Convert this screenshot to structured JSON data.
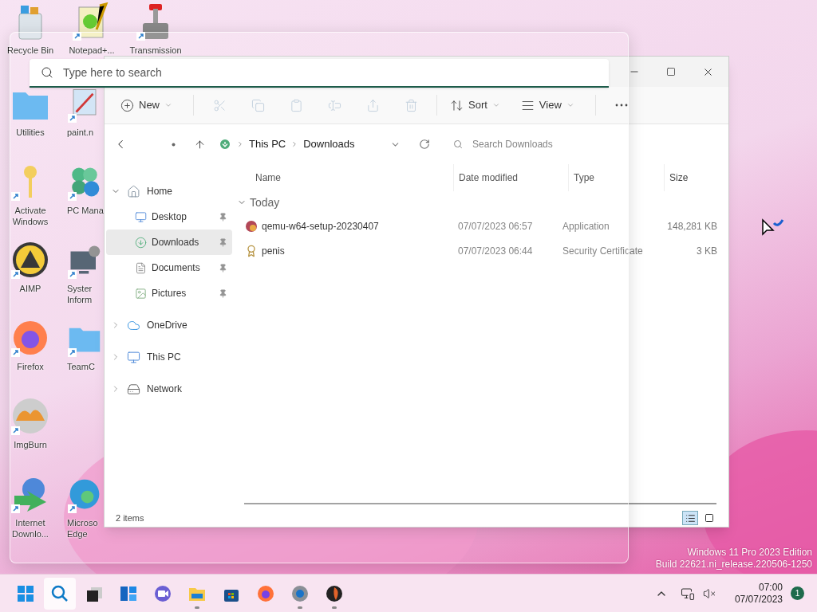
{
  "desktop_icons": [
    {
      "label": "Recycle Bin",
      "shortcut": false
    },
    {
      "label": "Notepad+...",
      "shortcut": true
    },
    {
      "label": "Transmission",
      "shortcut": true
    },
    {
      "label": "Utilities",
      "shortcut": false
    },
    {
      "label": "paint.n",
      "shortcut": true
    },
    {
      "label": "Activate Windows",
      "shortcut": true
    },
    {
      "label": "PC Mana",
      "shortcut": true
    },
    {
      "label": "AIMP",
      "shortcut": true
    },
    {
      "label": "Syster Inform",
      "shortcut": true
    },
    {
      "label": "Firefox",
      "shortcut": true
    },
    {
      "label": "TeamC",
      "shortcut": true
    },
    {
      "label": "ImgBurn",
      "shortcut": true
    },
    {
      "label": "Internet Downlo...",
      "shortcut": true
    },
    {
      "label": "Microso Edge",
      "shortcut": true
    }
  ],
  "search": {
    "placeholder": "Type here to search"
  },
  "explorer": {
    "toolbar": [
      {
        "label": "New",
        "disabled": false,
        "dropdown": true
      },
      {
        "disabled": true
      },
      {
        "disabled": true
      },
      {
        "disabled": true
      },
      {
        "disabled": true
      },
      {
        "disabled": true
      },
      {
        "disabled": true
      },
      {
        "label": "Sort",
        "disabled": false,
        "dropdown": true
      },
      {
        "label": "View",
        "disabled": false,
        "dropdown": true
      },
      {
        "disabled": false
      }
    ],
    "address": {
      "path": [
        "This PC",
        "Downloads"
      ],
      "search_placeholder": "Search Downloads"
    },
    "sidebar": [
      {
        "label": "Home",
        "expanded": true,
        "selected": false,
        "children": [
          {
            "label": "Desktop",
            "selected": false,
            "pinned": true
          },
          {
            "label": "Downloads",
            "selected": true,
            "pinned": true
          },
          {
            "label": "Documents",
            "selected": false,
            "pinned": true
          },
          {
            "label": "Pictures",
            "selected": false,
            "pinned": true
          }
        ]
      },
      {
        "label": "OneDrive",
        "expanded": false,
        "selected": false
      },
      {
        "label": "This PC",
        "expanded": false,
        "selected": false
      },
      {
        "label": "Network",
        "expanded": false,
        "selected": false
      }
    ],
    "columns": [
      "Name",
      "Date modified",
      "Type",
      "Size"
    ],
    "groups": [
      {
        "label": "Today",
        "expanded": true,
        "rows": [
          {
            "name": "qemu-w64-setup-20230407",
            "date": "07/07/2023 06:57",
            "type": "Application",
            "size": "148,281 KB"
          },
          {
            "name": "penis",
            "date": "07/07/2023 06:44",
            "type": "Security Certificate",
            "size": "3 KB"
          }
        ]
      }
    ],
    "status": "2 items",
    "views": [
      {
        "selected": true
      },
      {
        "selected": false
      }
    ]
  },
  "watermark": [
    "Windows 11 Pro 2023 Edition",
    "Build 22621.ni_release.220506-1250"
  ],
  "taskbar": {
    "apps": [
      {
        "selected": false,
        "running": false
      },
      {
        "selected": true,
        "running": false
      },
      {
        "selected": false,
        "running": false
      },
      {
        "selected": false,
        "running": false
      },
      {
        "selected": false,
        "running": false
      },
      {
        "selected": false,
        "running": true
      },
      {
        "selected": false,
        "running": false
      },
      {
        "selected": false,
        "running": false
      },
      {
        "selected": false,
        "running": true
      },
      {
        "selected": false,
        "running": true
      }
    ],
    "time": "07:00",
    "date": "07/07/2023",
    "notifications": "1"
  }
}
